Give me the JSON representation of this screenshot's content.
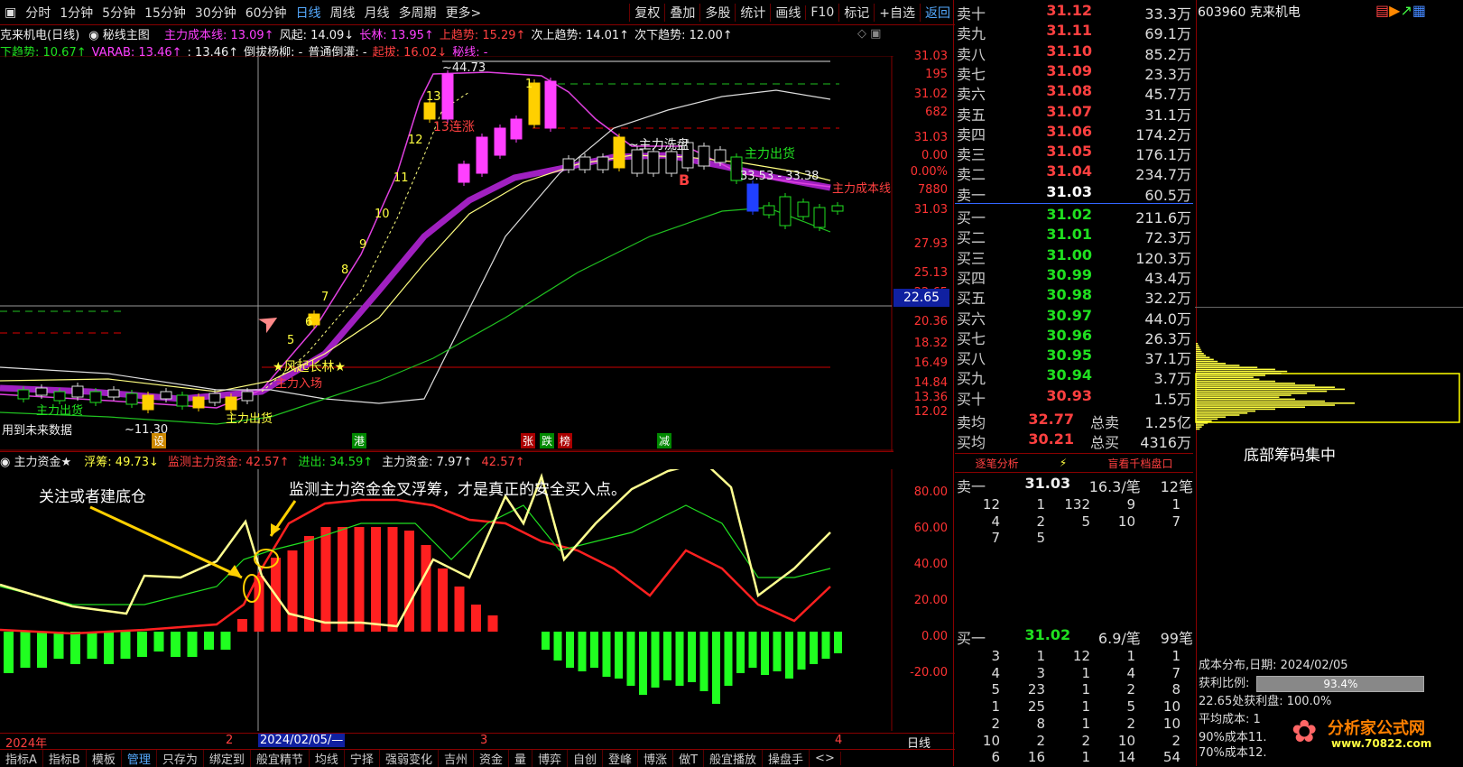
{
  "toolbar": {
    "items": [
      "分时",
      "1分钟",
      "5分钟",
      "15分钟",
      "30分钟",
      "60分钟",
      "日线",
      "周线",
      "月线",
      "多周期",
      "更多>"
    ],
    "right_items": [
      "复权",
      "叠加",
      "多股",
      "统计",
      "画线",
      "F10",
      "标记",
      "+自选",
      "返回"
    ],
    "active": "日线"
  },
  "chart_header": {
    "stock": "克来机电(日线)",
    "main_fig": "秘线主图",
    "items": [
      {
        "text": "主力成本线: 13.09↑",
        "color": "#ff40ff"
      },
      {
        "text": "风起: 14.09↓",
        "color": "#eeeeee"
      },
      {
        "text": "长林: 13.95↑",
        "color": "#ff40ff"
      },
      {
        "text": "上趋势: 15.29↑",
        "color": "#ff4040"
      },
      {
        "text": "次上趋势: 14.01↑",
        "color": "#eeeeee"
      },
      {
        "text": "次下趋势: 12.00↑",
        "color": "#eeeeee"
      }
    ],
    "items2": [
      {
        "text": "下趋势: 10.67↑",
        "color": "#20e020"
      },
      {
        "text": "VARAB: 13.46↑",
        "color": "#ff40ff"
      },
      {
        "text": ": 13.46↑",
        "color": "#eeeeee"
      },
      {
        "text": "倒拔杨柳: -",
        "color": "#eeeeee"
      },
      {
        "text": "普通倒灌: -",
        "color": "#eeeeee"
      },
      {
        "text": "起拔: 16.02↓",
        "color": "#ff4040"
      },
      {
        "text": "秘线: -",
        "color": "#ff40ff"
      }
    ]
  },
  "price_axis": [
    "31.03",
    "195",
    "31.02",
    "682",
    "31.03",
    "0.00",
    "0.00%",
    "7880",
    "31.03",
    "27.93",
    "25.13",
    "22.65",
    "22.82",
    "20.36",
    "18.32",
    "16.49",
    "14.84",
    "13.36",
    "12.02"
  ],
  "crosshair_price": "22.65",
  "annotations": {
    "peak": "~44.73",
    "zhuli_xipan": "~主力洗盘",
    "zhuli_chuhuo": "主力出货",
    "zhuli_chengben": "主力成本线",
    "range_text": "33.53 - 33.38",
    "fengqi": "★风起长林★",
    "zhuli_ruchang": "主力入场",
    "yongdao": "用到未来数据",
    "low": "~11.30",
    "shezhi": "设",
    "gang": "港",
    "zhangtie": "张",
    "die": "跌",
    "bang": "榜",
    "jian": "减",
    "b_mark": "B",
    "lianzhang": "13连涨",
    "count_labels": [
      "5",
      "6",
      "7",
      "8",
      "9",
      "10",
      "11",
      "12",
      "13",
      "1"
    ]
  },
  "indicator": {
    "header_name": "主力资金★",
    "items": [
      {
        "text": "浮筹: 49.73↓",
        "color": "#ffff40"
      },
      {
        "text": "监测主力资金: 42.57↑",
        "color": "#ff4040"
      },
      {
        "text": "进出: 34.59↑",
        "color": "#20e020"
      },
      {
        "text": "主力资金: 7.97↑",
        "color": "#eeeeee"
      },
      {
        "text": "42.57↑",
        "color": "#ff4040"
      }
    ],
    "axis": [
      "80.00",
      "60.00",
      "40.00",
      "20.00",
      "0.00",
      "-20.00"
    ],
    "note1": "关注或者建底仓",
    "note2": "监测主力资金金叉浮筹，才是真正的安全买入点。"
  },
  "x_axis": {
    "year": "2024年",
    "marks": [
      "2",
      "2024/02/05/—",
      "3",
      "4"
    ],
    "period": "日线"
  },
  "bottom_tabs": [
    "指标A",
    "指标B",
    "模板",
    "管理",
    "只存为",
    "绑定到",
    "般宜精节",
    "均线",
    "宁择",
    "强弱变化",
    "吉州",
    "资金",
    "量",
    "博弈",
    "自创",
    "登峰",
    "博涨",
    "做T",
    "般宜播放",
    "操盘手",
    "<>"
  ],
  "orderbook": {
    "asks": [
      {
        "label": "卖十",
        "price": "31.12",
        "vol": "33.3万"
      },
      {
        "label": "卖九",
        "price": "31.11",
        "vol": "69.1万"
      },
      {
        "label": "卖八",
        "price": "31.10",
        "vol": "85.2万"
      },
      {
        "label": "卖七",
        "price": "31.09",
        "vol": "23.3万"
      },
      {
        "label": "卖六",
        "price": "31.08",
        "vol": "45.7万"
      },
      {
        "label": "卖五",
        "price": "31.07",
        "vol": "31.1万"
      },
      {
        "label": "卖四",
        "price": "31.06",
        "vol": "174.2万"
      },
      {
        "label": "卖三",
        "price": "31.05",
        "vol": "176.1万"
      },
      {
        "label": "卖二",
        "price": "31.04",
        "vol": "234.7万"
      },
      {
        "label": "卖一",
        "price": "31.03",
        "vol": "60.5万"
      }
    ],
    "bids": [
      {
        "label": "买一",
        "price": "31.02",
        "vol": "211.6万"
      },
      {
        "label": "买二",
        "price": "31.01",
        "vol": "72.3万"
      },
      {
        "label": "买三",
        "price": "31.00",
        "vol": "120.3万"
      },
      {
        "label": "买四",
        "price": "30.99",
        "vol": "43.4万"
      },
      {
        "label": "买五",
        "price": "30.98",
        "vol": "32.2万"
      },
      {
        "label": "买六",
        "price": "30.97",
        "vol": "44.0万"
      },
      {
        "label": "买七",
        "price": "30.96",
        "vol": "26.3万"
      },
      {
        "label": "买八",
        "price": "30.95",
        "vol": "37.1万"
      },
      {
        "label": "买九",
        "price": "30.94",
        "vol": "3.7万"
      },
      {
        "label": "买十",
        "price": "30.93",
        "vol": "1.5万"
      }
    ],
    "avg_sell": {
      "label": "卖均",
      "price": "32.77",
      "tlabel": "总卖",
      "tval": "1.25亿"
    },
    "avg_buy": {
      "label": "买均",
      "price": "30.21",
      "tlabel": "总买",
      "tval": "4316万"
    },
    "tabs": [
      "逐笔分析",
      "⚡",
      "盲看千档盘口"
    ],
    "sell1": {
      "label": "卖一",
      "price": "31.03",
      "per": "16.3/笔",
      "count": "12笔"
    },
    "sell_grid": [
      [
        "12",
        "1",
        "132",
        "9",
        "1"
      ],
      [
        "4",
        "2",
        "5",
        "10",
        "7"
      ],
      [
        "7",
        "5",
        "",
        "",
        ""
      ]
    ],
    "buy1": {
      "label": "买一",
      "price": "31.02",
      "per": "6.9/笔",
      "count": "99笔"
    },
    "buy_grid": [
      [
        "3",
        "1",
        "12",
        "1",
        "1"
      ],
      [
        "4",
        "3",
        "1",
        "4",
        "7"
      ],
      [
        "5",
        "23",
        "1",
        "2",
        "8"
      ],
      [
        "1",
        "25",
        "1",
        "5",
        "10"
      ],
      [
        "2",
        "8",
        "1",
        "2",
        "10"
      ],
      [
        "10",
        "2",
        "2",
        "10",
        "2"
      ],
      [
        "6",
        "16",
        "1",
        "14",
        "54"
      ]
    ]
  },
  "right_panel": {
    "code": "603960 克来机电",
    "chip_label": "底部筹码集中",
    "dist_date": "成本分布,日期: 2024/02/05",
    "profit_label": "获利比例:",
    "profit_val": "93.4%",
    "profit_at": "22.65处获利盘: 100.0%",
    "avg_cost": "平均成本: 1",
    "cost90": "90%成本11.",
    "cost70": "70%成本12.",
    "watermark": "分析家公式网",
    "watermark_url": "www.70822.com"
  }
}
